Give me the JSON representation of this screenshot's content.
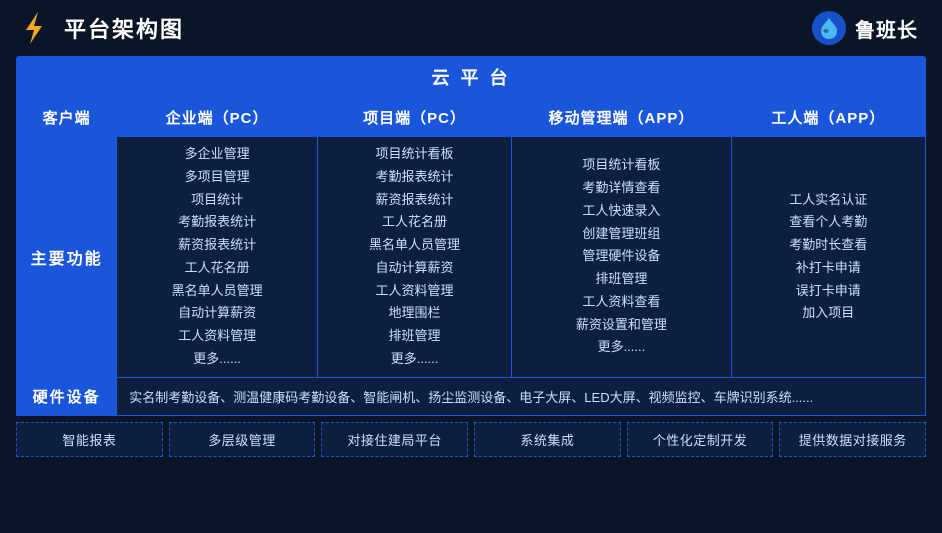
{
  "header": {
    "title": "平台架构图",
    "brand": "鲁班长"
  },
  "cloud_platform": "云 平 台",
  "columns": [
    {
      "id": "client",
      "label": "客户端"
    },
    {
      "id": "enterprise",
      "label": "企业端（PC）"
    },
    {
      "id": "project_pc",
      "label": "项目端（PC）"
    },
    {
      "id": "mobile_app",
      "label": "移动管理端（APP）"
    },
    {
      "id": "worker_app",
      "label": "工人端（APP）"
    }
  ],
  "row_main_label": "主要功能",
  "features": {
    "enterprise": "多企业管理\n多项目管理\n项目统计\n考勤报表统计\n薪资报表统计\n工人花名册\n黑名单人员管理\n自动计算薪资\n工人资料管理\n更多......",
    "project_pc": "项目统计看板\n考勤报表统计\n薪资报表统计\n工人花名册\n黑名单人员管理\n自动计算薪资\n工人资料管理\n地理围栏\n排班管理\n更多......",
    "mobile_app": "项目统计看板\n考勤详情查看\n工人快速录入\n创建管理班组\n管理硬件设备\n排班管理\n工人资料查看\n薪资设置和管理\n更多......",
    "worker_app": "工人实名认证\n查看个人考勤\n考勤时长查看\n补打卡申请\n误打卡申请\n加入项目"
  },
  "hardware": {
    "label": "硬件设备",
    "content": "实名制考勤设备、测温健康码考勤设备、智能闸机、扬尘监测设备、电子大屏、LED大屏、视频监控、车牌识别系统......"
  },
  "bottom_features": [
    "智能报表",
    "多层级管理",
    "对接住建局平台",
    "系统集成",
    "个性化定制开发",
    "提供数据对接服务"
  ]
}
